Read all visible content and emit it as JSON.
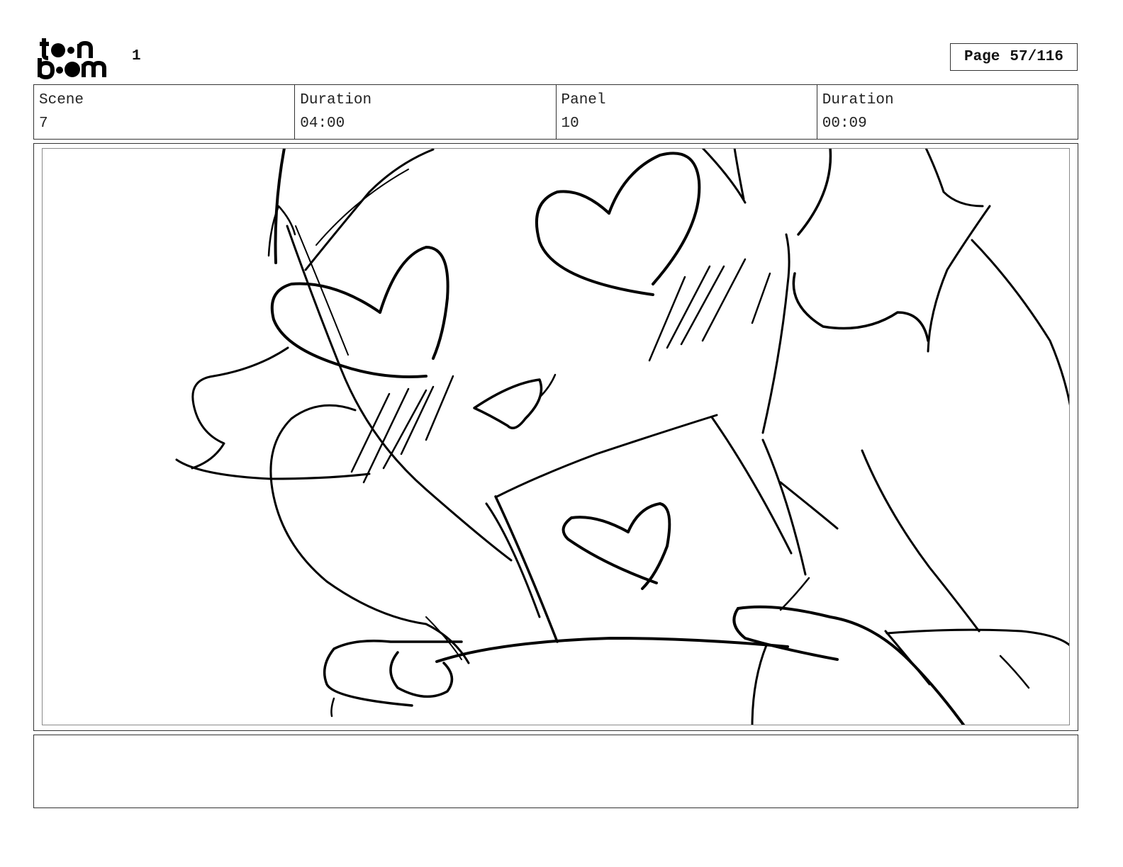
{
  "header": {
    "logo_text": "toon boom",
    "page_number": "1",
    "page_label": "Page",
    "page_value": "57/116"
  },
  "info": {
    "scene_label": "Scene",
    "scene_value": "7",
    "scene_duration_label": "Duration",
    "scene_duration_value": "04:00",
    "panel_label": "Panel",
    "panel_value": "10",
    "panel_duration_label": "Duration",
    "panel_duration_value": "00:09"
  },
  "notes": {
    "text": ""
  }
}
